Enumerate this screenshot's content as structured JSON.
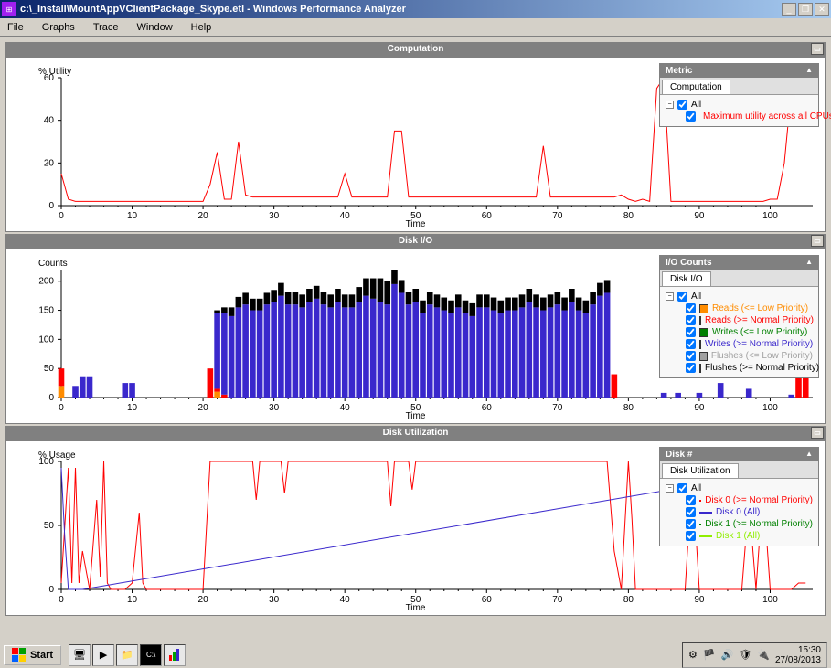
{
  "title": "c:\\_Install\\MountAppVClientPackage_Skype.etl - Windows Performance Analyzer",
  "menubar": [
    "File",
    "Graphs",
    "Trace",
    "Window",
    "Help"
  ],
  "taskbar": {
    "start": "Start",
    "time": "15:30",
    "date": "27/08/2013"
  },
  "panels": {
    "computation": {
      "title": "Computation",
      "y_label": "% Utility",
      "x_label": "Time",
      "legend": {
        "title": "Metric",
        "tab": "Computation",
        "all": "All",
        "item1": "Maximum utility across all CPUs"
      }
    },
    "diskio": {
      "title": "Disk I/O",
      "y_label": "Counts",
      "x_label": "Time",
      "legend": {
        "title": "I/O Counts",
        "tab": "Disk I/O",
        "all": "All",
        "item1": "Reads (<= Low Priority)",
        "item2": "Reads (>= Normal Priority)",
        "item3": "Writes (<= Low Priority)",
        "item4": "Writes (>= Normal Priority)",
        "item5": "Flushes (<= Low Priority)",
        "item6": "Flushes (>= Normal Priority)"
      }
    },
    "diskutil": {
      "title": "Disk Utilization",
      "y_label": "% Usage",
      "x_label": "Time",
      "legend": {
        "title": "Disk #",
        "tab": "Disk Utilization",
        "all": "All",
        "item1": "Disk 0 (>= Normal Priority)",
        "item2": "Disk 0 (All)",
        "item3": "Disk 1 (>= Normal Priority)",
        "item4": "Disk 1 (All)"
      }
    }
  },
  "colors": {
    "red": "#ff0000",
    "darkred": "#8b0000",
    "blue": "#3a28cc",
    "navy": "#000080",
    "orange": "#ff8c00",
    "green": "#008000",
    "lime": "#90ee00",
    "gray": "#a0a0a0",
    "black": "#000000"
  },
  "chart_data": [
    {
      "type": "line",
      "title": "Computation",
      "xlabel": "Time",
      "ylabel": "% Utility",
      "xlim": [
        0,
        106
      ],
      "ylim": [
        0,
        60
      ],
      "xticks": [
        0,
        10,
        20,
        30,
        40,
        50,
        60,
        70,
        80,
        90,
        100
      ],
      "yticks": [
        0,
        20,
        40,
        60
      ],
      "series": [
        {
          "name": "Maximum utility across all CPUs",
          "color": "#ff0000",
          "x": [
            0,
            1,
            2,
            3,
            4,
            5,
            6,
            7,
            8,
            9,
            10,
            11,
            12,
            13,
            14,
            15,
            16,
            17,
            18,
            19,
            20,
            21,
            22,
            23,
            24,
            25,
            26,
            27,
            28,
            29,
            30,
            31,
            32,
            33,
            34,
            35,
            36,
            37,
            38,
            39,
            40,
            41,
            42,
            43,
            44,
            45,
            46,
            47,
            48,
            49,
            50,
            51,
            52,
            53,
            54,
            55,
            56,
            57,
            58,
            59,
            60,
            61,
            62,
            63,
            64,
            65,
            66,
            67,
            68,
            69,
            70,
            71,
            72,
            73,
            74,
            75,
            76,
            77,
            78,
            79,
            80,
            81,
            82,
            83,
            84,
            85,
            86,
            87,
            88,
            89,
            90,
            91,
            92,
            93,
            94,
            95,
            96,
            97,
            98,
            99,
            100,
            101,
            102,
            103,
            104,
            105
          ],
          "y": [
            15,
            3,
            2,
            2,
            2,
            2,
            2,
            2,
            2,
            2,
            2,
            2,
            2,
            2,
            2,
            2,
            2,
            2,
            2,
            2,
            2,
            10,
            25,
            3,
            3,
            30,
            5,
            4,
            4,
            4,
            4,
            4,
            4,
            4,
            4,
            4,
            4,
            4,
            4,
            4,
            15,
            4,
            4,
            4,
            4,
            4,
            4,
            35,
            35,
            4,
            4,
            4,
            4,
            4,
            4,
            4,
            4,
            4,
            4,
            4,
            4,
            4,
            4,
            4,
            4,
            4,
            4,
            4,
            28,
            4,
            4,
            4,
            4,
            4,
            4,
            4,
            4,
            4,
            4,
            5,
            3,
            2,
            3,
            2,
            55,
            60,
            2,
            2,
            2,
            2,
            2,
            2,
            2,
            2,
            2,
            2,
            2,
            2,
            2,
            2,
            3,
            3,
            20,
            55,
            60,
            60
          ]
        }
      ]
    },
    {
      "type": "bar",
      "title": "Disk I/O",
      "xlabel": "Time",
      "ylabel": "Counts",
      "xlim": [
        0,
        106
      ],
      "ylim": [
        0,
        220
      ],
      "xticks": [
        0,
        10,
        20,
        30,
        40,
        50,
        60,
        70,
        80,
        90,
        100
      ],
      "yticks": [
        0,
        50,
        100,
        150,
        200
      ],
      "categories_x": [
        0,
        1,
        2,
        3,
        4,
        5,
        6,
        7,
        8,
        9,
        10,
        11,
        12,
        13,
        14,
        15,
        16,
        17,
        18,
        19,
        20,
        21,
        22,
        23,
        24,
        25,
        26,
        27,
        28,
        29,
        30,
        31,
        32,
        33,
        34,
        35,
        36,
        37,
        38,
        39,
        40,
        41,
        42,
        43,
        44,
        45,
        46,
        47,
        48,
        49,
        50,
        51,
        52,
        53,
        54,
        55,
        56,
        57,
        58,
        59,
        60,
        61,
        62,
        63,
        64,
        65,
        66,
        67,
        68,
        69,
        70,
        71,
        72,
        73,
        74,
        75,
        76,
        77,
        78,
        79,
        80,
        81,
        82,
        83,
        84,
        85,
        86,
        87,
        88,
        89,
        90,
        91,
        92,
        93,
        94,
        95,
        96,
        97,
        98,
        99,
        100,
        101,
        102,
        103,
        104,
        105
      ],
      "series": [
        {
          "name": "Reads (<= Low Priority)",
          "color": "#ff8c00",
          "values": [
            20,
            0,
            0,
            0,
            0,
            0,
            0,
            0,
            0,
            0,
            0,
            0,
            0,
            0,
            0,
            0,
            0,
            0,
            0,
            0,
            0,
            0,
            10,
            0,
            0,
            0,
            0,
            0,
            0,
            0,
            0,
            0,
            0,
            0,
            0,
            0,
            0,
            0,
            0,
            0,
            0,
            0,
            0,
            0,
            0,
            0,
            0,
            0,
            0,
            0,
            0,
            0,
            0,
            0,
            0,
            0,
            0,
            0,
            0,
            0,
            0,
            0,
            0,
            0,
            0,
            0,
            0,
            0,
            0,
            0,
            0,
            0,
            0,
            0,
            0,
            0,
            0,
            0,
            0,
            0,
            0,
            0,
            0,
            0,
            0,
            0,
            0,
            0,
            0,
            0,
            0,
            0,
            0,
            0,
            0,
            0,
            0,
            0,
            0,
            0,
            0,
            0,
            0,
            0,
            0,
            0
          ]
        },
        {
          "name": "Reads (>= Normal Priority)",
          "color": "#ff0000",
          "values": [
            30,
            0,
            0,
            0,
            0,
            0,
            0,
            0,
            0,
            0,
            0,
            0,
            0,
            0,
            0,
            0,
            0,
            0,
            0,
            0,
            0,
            50,
            5,
            5,
            0,
            0,
            0,
            0,
            0,
            0,
            0,
            0,
            0,
            0,
            0,
            0,
            0,
            0,
            0,
            0,
            0,
            0,
            0,
            0,
            0,
            0,
            0,
            0,
            0,
            0,
            0,
            0,
            0,
            0,
            0,
            0,
            0,
            0,
            0,
            0,
            0,
            0,
            0,
            0,
            0,
            0,
            0,
            0,
            0,
            0,
            0,
            0,
            0,
            0,
            0,
            0,
            0,
            0,
            40,
            0,
            0,
            0,
            0,
            0,
            0,
            0,
            0,
            0,
            0,
            0,
            0,
            0,
            0,
            0,
            0,
            0,
            0,
            0,
            0,
            0,
            0,
            0,
            0,
            0,
            60,
            60
          ]
        },
        {
          "name": "Writes (>= Normal Priority)",
          "color": "#3a28cc",
          "values": [
            0,
            0,
            20,
            35,
            35,
            0,
            0,
            0,
            0,
            25,
            25,
            0,
            0,
            0,
            0,
            0,
            0,
            0,
            0,
            0,
            0,
            0,
            130,
            140,
            140,
            155,
            160,
            150,
            150,
            160,
            165,
            175,
            160,
            160,
            155,
            165,
            170,
            160,
            155,
            165,
            155,
            155,
            165,
            175,
            170,
            165,
            160,
            195,
            180,
            160,
            165,
            145,
            160,
            155,
            150,
            145,
            155,
            145,
            140,
            155,
            155,
            150,
            145,
            150,
            150,
            155,
            165,
            155,
            150,
            155,
            160,
            150,
            165,
            150,
            145,
            160,
            175,
            180,
            0,
            0,
            0,
            0,
            0,
            0,
            0,
            8,
            0,
            8,
            0,
            0,
            8,
            0,
            0,
            25,
            0,
            0,
            0,
            15,
            0,
            0,
            0,
            0,
            0,
            5,
            0,
            0
          ]
        },
        {
          "name": "Flushes (>= Normal Priority)",
          "color": "#000000",
          "values": [
            0,
            0,
            0,
            0,
            0,
            0,
            0,
            0,
            0,
            0,
            0,
            0,
            0,
            0,
            0,
            0,
            0,
            0,
            0,
            0,
            0,
            0,
            5,
            10,
            15,
            18,
            20,
            20,
            20,
            20,
            20,
            22,
            22,
            22,
            22,
            22,
            22,
            22,
            22,
            22,
            22,
            22,
            25,
            30,
            35,
            40,
            40,
            25,
            22,
            22,
            22,
            22,
            22,
            22,
            22,
            22,
            22,
            22,
            22,
            22,
            22,
            22,
            22,
            22,
            22,
            22,
            22,
            22,
            22,
            22,
            22,
            22,
            22,
            22,
            22,
            22,
            22,
            22,
            0,
            0,
            0,
            0,
            0,
            0,
            0,
            0,
            0,
            0,
            0,
            0,
            0,
            0,
            0,
            0,
            0,
            0,
            0,
            0,
            0,
            0,
            0,
            0,
            0,
            0,
            0,
            0
          ]
        }
      ]
    },
    {
      "type": "line",
      "title": "Disk Utilization",
      "xlabel": "Time",
      "ylabel": "% Usage",
      "xlim": [
        0,
        106
      ],
      "ylim": [
        0,
        100
      ],
      "xticks": [
        0,
        10,
        20,
        30,
        40,
        50,
        60,
        70,
        80,
        90,
        100
      ],
      "yticks": [
        0,
        50,
        100
      ],
      "series": [
        {
          "name": "Disk 0 (>= Normal Priority)",
          "color": "#ff0000",
          "x": [
            0,
            1,
            1.5,
            2,
            2.5,
            3,
            4,
            5,
            5.5,
            6,
            6.5,
            7,
            8,
            9,
            10,
            11,
            11.5,
            12,
            13,
            14,
            15,
            16,
            17,
            18,
            19,
            20,
            21,
            22,
            23,
            24,
            25,
            26,
            27,
            27.5,
            28,
            29,
            30,
            31,
            31.5,
            32,
            33,
            34,
            35,
            36,
            37,
            38,
            39,
            40,
            41,
            42,
            43,
            44,
            45,
            46,
            46.5,
            47,
            48,
            49,
            49.5,
            50,
            51,
            52,
            53,
            54,
            55,
            56,
            57,
            58,
            59,
            60,
            61,
            62,
            63,
            64,
            65,
            66,
            67,
            68,
            69,
            70,
            71,
            72,
            73,
            74,
            75,
            76,
            77,
            78,
            79,
            80,
            80.5,
            81,
            82,
            83,
            84,
            85,
            86,
            87,
            88,
            89,
            90,
            91,
            92,
            93,
            94,
            95,
            96,
            97,
            98,
            99,
            100,
            101,
            102,
            103,
            104,
            105
          ],
          "y": [
            5,
            95,
            5,
            95,
            5,
            30,
            0,
            70,
            10,
            100,
            5,
            0,
            0,
            0,
            5,
            60,
            5,
            0,
            0,
            0,
            0,
            0,
            0,
            0,
            0,
            0,
            100,
            100,
            100,
            100,
            100,
            100,
            100,
            70,
            100,
            100,
            100,
            100,
            75,
            100,
            100,
            100,
            100,
            100,
            100,
            100,
            100,
            100,
            100,
            100,
            100,
            100,
            100,
            100,
            65,
            100,
            100,
            100,
            78,
            100,
            100,
            100,
            100,
            100,
            100,
            100,
            100,
            100,
            100,
            100,
            100,
            100,
            100,
            100,
            100,
            100,
            100,
            100,
            100,
            100,
            100,
            100,
            100,
            100,
            100,
            100,
            100,
            30,
            0,
            100,
            55,
            0,
            0,
            0,
            0,
            0,
            0,
            0,
            0,
            90,
            0,
            0,
            0,
            0,
            0,
            0,
            0,
            70,
            0,
            80,
            0,
            0,
            0,
            0,
            5,
            5
          ]
        },
        {
          "name": "Disk 0 (All)",
          "color": "#3a28cc",
          "x": [
            0,
            0.5,
            1,
            2,
            3,
            104,
            105
          ],
          "y": [
            95,
            40,
            0,
            0,
            0,
            95,
            90
          ]
        }
      ]
    }
  ]
}
